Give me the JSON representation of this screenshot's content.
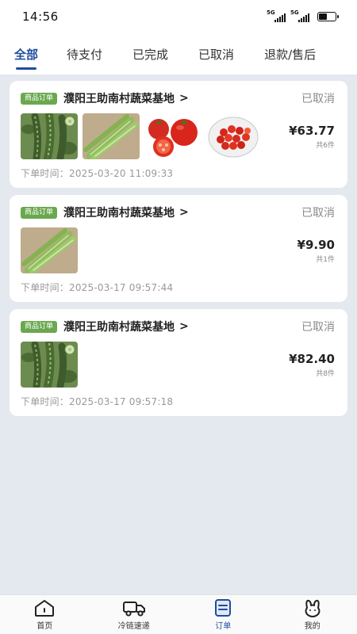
{
  "status_bar": {
    "time": "14:56",
    "signal1": "5G",
    "signal2": "5G",
    "battery_level": 0.55
  },
  "tabs": [
    {
      "label": "全部",
      "active": true
    },
    {
      "label": "待支付",
      "active": false
    },
    {
      "label": "已完成",
      "active": false
    },
    {
      "label": "已取消",
      "active": false
    },
    {
      "label": "退款/售后",
      "active": false
    }
  ],
  "orders": [
    {
      "tag": "商品订单",
      "shop": "濮阳王助南村蔬菜基地",
      "status": "已取消",
      "price": "¥63.77",
      "count": "共6件",
      "time_label": "下单时间：",
      "time": "2025-03-20 11:09:33",
      "items": [
        "loofah",
        "celtuce",
        "tomato",
        "cherry-tomato"
      ]
    },
    {
      "tag": "商品订单",
      "shop": "濮阳王助南村蔬菜基地",
      "status": "已取消",
      "price": "¥9.90",
      "count": "共1件",
      "time_label": "下单时间：",
      "time": "2025-03-17 09:57:44",
      "items": [
        "celtuce"
      ]
    },
    {
      "tag": "商品订单",
      "shop": "濮阳王助南村蔬菜基地",
      "status": "已取消",
      "price": "¥82.40",
      "count": "共8件",
      "time_label": "下单时间：",
      "time": "2025-03-17 09:57:18",
      "items": [
        "loofah"
      ]
    }
  ],
  "bottom_nav": [
    {
      "label": "首页",
      "icon": "home-icon",
      "active": false
    },
    {
      "label": "冷链速递",
      "icon": "truck-icon",
      "active": false
    },
    {
      "label": "订单",
      "icon": "order-icon",
      "active": true
    },
    {
      "label": "我的",
      "icon": "profile-icon",
      "active": false
    }
  ],
  "colors": {
    "accent": "#1f4e9b",
    "tag_green": "#6aa84f",
    "background": "#e4e8ef"
  }
}
